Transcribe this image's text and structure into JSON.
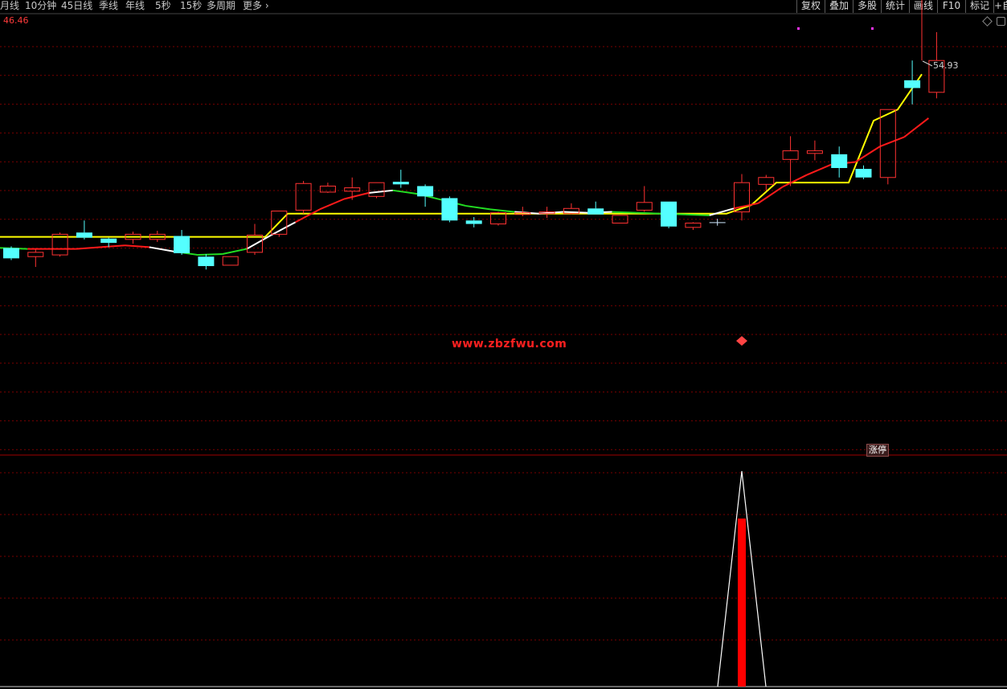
{
  "toolbar": {
    "periods": [
      "月线",
      "10分钟",
      "45日线",
      "季线",
      "年线",
      "5秒",
      "15秒",
      "多周期",
      "更多"
    ],
    "actions": [
      "复权",
      "叠加",
      "多股",
      "统计",
      "画线",
      "F10",
      "标记",
      "+自"
    ]
  },
  "chart": {
    "top_price_label": "46.46",
    "peak_price_label": "54.93",
    "limit_up_badge": "涨停",
    "watermark": "www.zbzfwu.com"
  },
  "colors": {
    "up_candle": "#ff3232",
    "down_candle": "#54ffff",
    "ma_red": "#ff1a1a",
    "ma_green": "#22dd22",
    "ma_white": "#ffffff",
    "ma_yellow": "#ffff00",
    "grid": "#7a0000",
    "indicator_bar": "#ff0000"
  },
  "chart_data": {
    "type": "candlestick",
    "y_top_label": 46.46,
    "peak": 54.93,
    "candles": [
      {
        "o": 24.0,
        "c": 22.8,
        "h": 24.2,
        "l": 22.6,
        "dir": "down"
      },
      {
        "o": 23.0,
        "c": 23.5,
        "h": 23.9,
        "l": 21.8,
        "dir": "up"
      },
      {
        "o": 23.2,
        "c": 25.6,
        "h": 25.8,
        "l": 23.0,
        "dir": "up"
      },
      {
        "o": 25.8,
        "c": 25.2,
        "h": 27.2,
        "l": 25.0,
        "dir": "down"
      },
      {
        "o": 25.1,
        "c": 24.6,
        "h": 25.2,
        "l": 24.1,
        "dir": "down"
      },
      {
        "o": 25.0,
        "c": 25.6,
        "h": 25.9,
        "l": 24.5,
        "dir": "up"
      },
      {
        "o": 25.0,
        "c": 25.6,
        "h": 26.0,
        "l": 24.7,
        "dir": "up"
      },
      {
        "o": 25.4,
        "c": 23.4,
        "h": 26.1,
        "l": 23.2,
        "dir": "down"
      },
      {
        "o": 23.0,
        "c": 21.9,
        "h": 23.3,
        "l": 21.5,
        "dir": "down"
      },
      {
        "o": 22.0,
        "c": 23.0,
        "h": 23.0,
        "l": 22.0,
        "dir": "up"
      },
      {
        "o": 23.5,
        "c": 25.5,
        "h": 26.8,
        "l": 23.2,
        "dir": "up"
      },
      {
        "o": 25.6,
        "c": 28.3,
        "h": 28.3,
        "l": 25.3,
        "dir": "up"
      },
      {
        "o": 28.4,
        "c": 31.5,
        "h": 31.8,
        "l": 28.0,
        "dir": "up"
      },
      {
        "o": 30.5,
        "c": 31.2,
        "h": 31.6,
        "l": 30.4,
        "dir": "up"
      },
      {
        "o": 30.6,
        "c": 31.0,
        "h": 32.2,
        "l": 29.6,
        "dir": "up"
      },
      {
        "o": 30.0,
        "c": 31.6,
        "h": 31.6,
        "l": 29.8,
        "dir": "up"
      },
      {
        "o": 31.7,
        "c": 31.4,
        "h": 33.1,
        "l": 31.0,
        "dir": "down"
      },
      {
        "o": 31.2,
        "c": 30.0,
        "h": 31.4,
        "l": 28.8,
        "dir": "down"
      },
      {
        "o": 29.8,
        "c": 27.2,
        "h": 30.0,
        "l": 27.0,
        "dir": "down"
      },
      {
        "o": 27.2,
        "c": 26.8,
        "h": 27.6,
        "l": 26.4,
        "dir": "down"
      },
      {
        "o": 26.8,
        "c": 28.1,
        "h": 28.2,
        "l": 26.6,
        "dir": "up"
      },
      {
        "o": 27.9,
        "c": 28.1,
        "h": 28.8,
        "l": 27.7,
        "dir": "up"
      },
      {
        "o": 28.0,
        "c": 28.2,
        "h": 28.8,
        "l": 27.5,
        "dir": "up"
      },
      {
        "o": 28.0,
        "c": 28.6,
        "h": 29.2,
        "l": 27.9,
        "dir": "up"
      },
      {
        "o": 28.6,
        "c": 27.9,
        "h": 29.4,
        "l": 27.9,
        "dir": "down"
      },
      {
        "o": 26.9,
        "c": 27.8,
        "h": 27.8,
        "l": 26.9,
        "dir": "up"
      },
      {
        "o": 28.4,
        "c": 29.3,
        "h": 31.2,
        "l": 28.2,
        "dir": "up"
      },
      {
        "o": 29.4,
        "c": 26.5,
        "h": 29.4,
        "l": 26.3,
        "dir": "down"
      },
      {
        "o": 26.4,
        "c": 26.9,
        "h": 27.0,
        "l": 26.1,
        "dir": "up"
      },
      {
        "o": 27.0,
        "c": 27.0,
        "h": 27.4,
        "l": 26.6,
        "dir": "flat"
      },
      {
        "o": 28.2,
        "c": 31.6,
        "h": 32.6,
        "l": 27.2,
        "dir": "up"
      },
      {
        "o": 31.4,
        "c": 32.2,
        "h": 32.5,
        "l": 30.7,
        "dir": "up"
      },
      {
        "o": 34.3,
        "c": 35.3,
        "h": 37.0,
        "l": 31.2,
        "dir": "up"
      },
      {
        "o": 35.0,
        "c": 35.3,
        "h": 36.5,
        "l": 34.2,
        "dir": "up"
      },
      {
        "o": 34.9,
        "c": 33.3,
        "h": 35.8,
        "l": 32.2,
        "dir": "down"
      },
      {
        "o": 33.2,
        "c": 32.2,
        "h": 33.6,
        "l": 32.0,
        "dir": "down"
      },
      {
        "o": 32.2,
        "c": 40.1,
        "h": 40.1,
        "l": 31.4,
        "dir": "up"
      },
      {
        "o": 43.5,
        "c": 42.6,
        "h": 45.8,
        "l": 40.7,
        "dir": "down"
      },
      {
        "o": 42.1,
        "c": 45.8,
        "h": 49.1,
        "l": 41.4,
        "dir": "up"
      }
    ],
    "ma_red": [
      24.1,
      24.0,
      23.9,
      23.9,
      23.9,
      24.1,
      24.3,
      24.1,
      23.6,
      23.2,
      23.3,
      23.9,
      25.5,
      27.0,
      28.5,
      29.7,
      30.4,
      30.7,
      30.3,
      29.6,
      28.9,
      28.5,
      28.2,
      28.0,
      28.2,
      28.1,
      28.2,
      28.1,
      28.0,
      27.9,
      27.8,
      28.6,
      29.2,
      31.1,
      32.5,
      33.7,
      34.0,
      35.8,
      36.9,
      39.1
    ],
    "ma_yellow_level_1": 25.3,
    "ma_yellow_level_2": 28.0,
    "ma_yellow_level_3": 31.1,
    "indicator": {
      "signal_index": 30,
      "bar_height_pct": 78
    }
  }
}
